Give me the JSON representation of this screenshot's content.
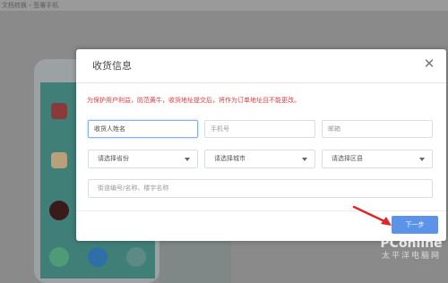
{
  "background": {
    "top_text": "文档转换 › 签署手机"
  },
  "modal": {
    "title": "收货信息",
    "notice": "为保护用户利益，防范黄牛，收货地址提交后，将作为订单地址且不能更改。",
    "fields": {
      "name_placeholder": "收货人姓名",
      "phone_placeholder": "手机号",
      "email_placeholder": "邮箱",
      "address_placeholder": "街道编号/名称、楼宇名称"
    },
    "selects": {
      "province": "请选择省份",
      "city": "请选择城市",
      "district": "请选择区县"
    },
    "next_label": "下一步"
  },
  "watermark": {
    "brand": "PConline",
    "subtitle": "太平洋电脑网"
  },
  "colors": {
    "notice": "#e23a3a",
    "primary_button": "#5b93e8",
    "overlay": "#8a8a8a"
  }
}
